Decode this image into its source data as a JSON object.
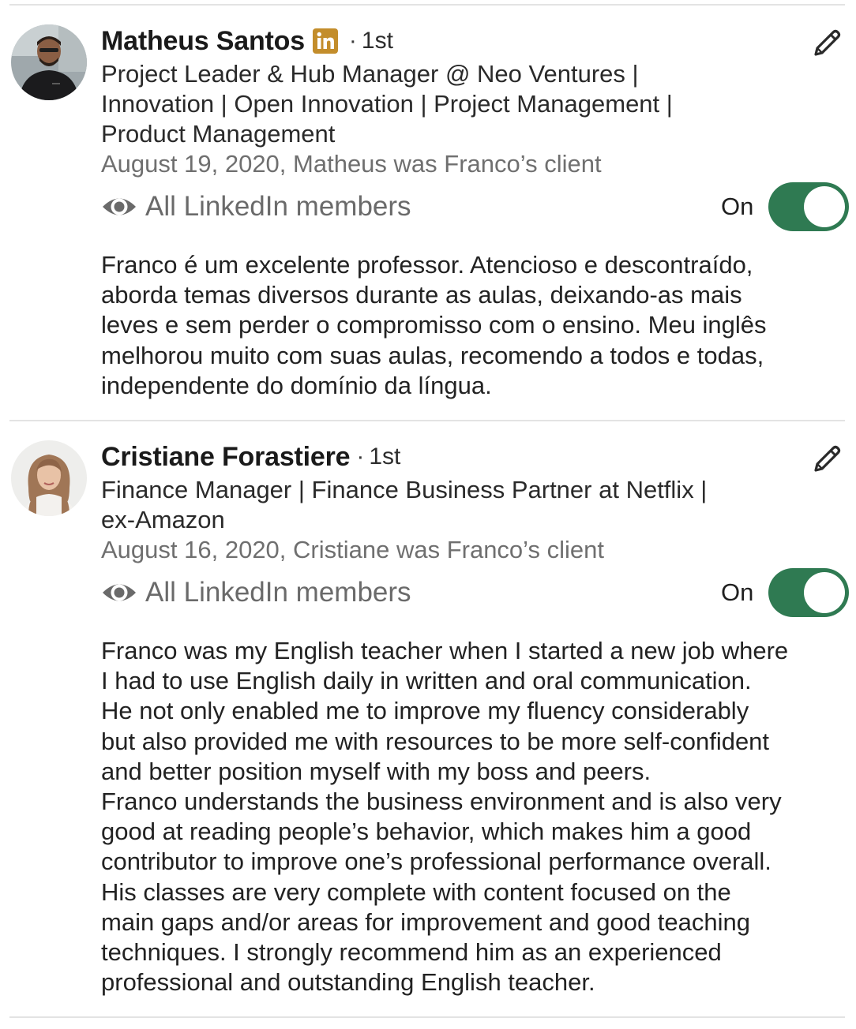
{
  "recommendations": [
    {
      "name": "Matheus Santos",
      "badge_icon": "linkedin-premium-icon",
      "separator": "·",
      "degree": "1st",
      "headline_lines": [
        "Project Leader & Hub Manager @ Neo Ventures |",
        "Innovation | Open Innovation | Project Management |",
        "Product Management"
      ],
      "date_relation": "August 19, 2020, Matheus was Franco’s client",
      "visibility_icon": "eye-icon",
      "visibility": "All LinkedIn members",
      "toggle_label": "On",
      "toggle_on": true,
      "body_lines": [
        "Franco é um excelente professor. Atencioso e descontraído,",
        "aborda temas diversos durante as aulas, deixando-as mais",
        "leves e sem perder o compromisso com o ensino. Meu inglês",
        "melhorou muito com suas aulas, recomendo a todos e todas,",
        "independente do domínio da língua."
      ]
    },
    {
      "name": "Cristiane Forastiere",
      "separator": "·",
      "degree": "1st",
      "headline_lines": [
        "Finance Manager | Finance Business Partner at Netflix |",
        "ex-Amazon"
      ],
      "date_relation": "August 16, 2020, Cristiane was Franco’s client",
      "visibility_icon": "eye-icon",
      "visibility": "All LinkedIn members",
      "toggle_label": "On",
      "toggle_on": true,
      "body_lines": [
        "Franco was my English teacher when I started a new job where",
        "I had to use English daily in written and oral communication.",
        "He not only enabled me to improve my fluency considerably",
        "but also provided me with resources to be more self-confident",
        "and better position myself with my boss and peers.",
        "Franco understands the business environment and is also very",
        "good at reading people’s behavior, which makes him a good",
        "contributor to improve one’s professional performance overall.",
        "His classes are very complete with content focused on the",
        "main gaps and/or areas for improvement and good teaching",
        "techniques. I strongly recommend him as an experienced",
        "professional and outstanding English teacher."
      ]
    }
  ],
  "colors": {
    "toggle_on": "#2f7a52",
    "linkedin_badge": "#c38d2b",
    "muted_text": "#6f6f6f"
  }
}
